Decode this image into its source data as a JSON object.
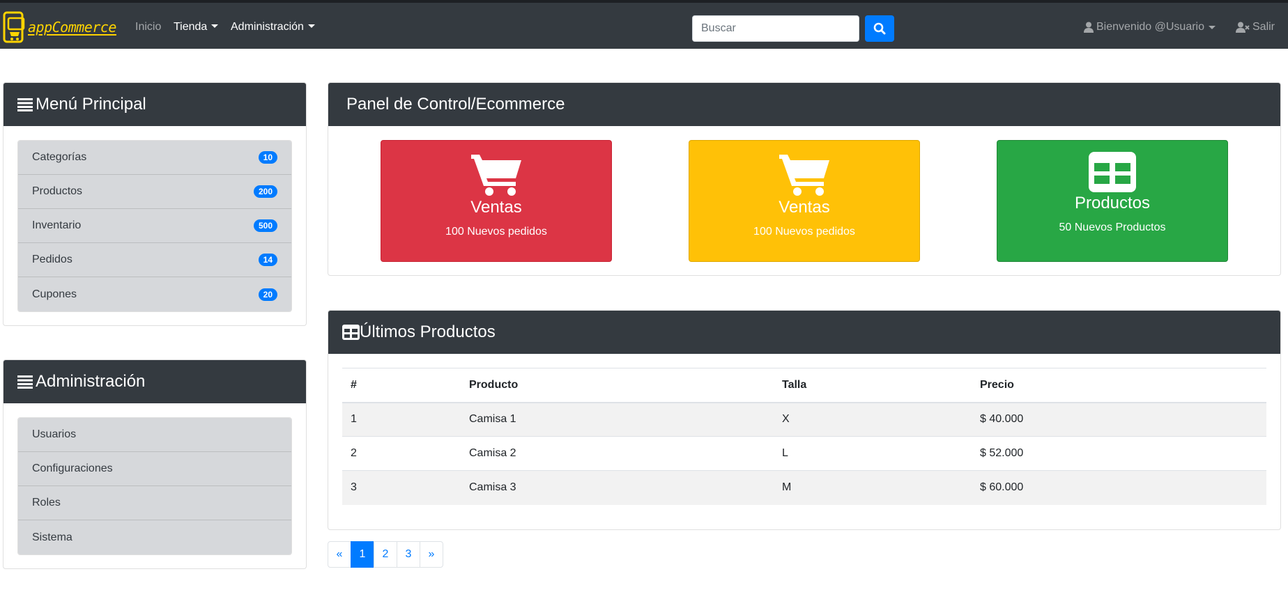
{
  "navbar": {
    "brand": "appCommerce",
    "inicio": "Inicio",
    "tienda": "Tienda",
    "administracion": "Administración",
    "search_placeholder": "Buscar",
    "welcome": "Bienvenido @Usuario",
    "logout": "Salir"
  },
  "menu_principal": {
    "title": "Menú Principal",
    "items": [
      {
        "label": "Categorías",
        "count": "10"
      },
      {
        "label": "Productos",
        "count": "200"
      },
      {
        "label": "Inventario",
        "count": "500"
      },
      {
        "label": "Pedidos",
        "count": "14"
      },
      {
        "label": "Cupones",
        "count": "20"
      }
    ]
  },
  "administracion": {
    "title": "Administración",
    "items": [
      "Usuarios",
      "Configuraciones",
      "Roles",
      "Sistema"
    ]
  },
  "panel": {
    "title": "Panel de Control/Ecommerce",
    "tiles": [
      {
        "title": "Ventas",
        "subtitle": "100 Nuevos pedidos",
        "color": "#dc3545",
        "icon": "cart-icon"
      },
      {
        "title": "Ventas",
        "subtitle": "100 Nuevos pedidos",
        "color": "#ffc107",
        "icon": "cart-icon"
      },
      {
        "title": "Productos",
        "subtitle": "50 Nuevos Productos",
        "color": "#28a745",
        "icon": "table-icon"
      }
    ]
  },
  "ultimos": {
    "title": "Últimos Productos",
    "columns": [
      "#",
      "Producto",
      "Talla",
      "Precio"
    ],
    "rows": [
      [
        "1",
        "Camisa 1",
        "X",
        "$ 40.000"
      ],
      [
        "2",
        "Camisa 2",
        "L",
        "$ 52.000"
      ],
      [
        "3",
        "Camisa 3",
        "M",
        "$ 60.000"
      ]
    ]
  },
  "pagination": {
    "prev": "«",
    "pages": [
      "1",
      "2",
      "3"
    ],
    "active": "1",
    "next": "»"
  }
}
